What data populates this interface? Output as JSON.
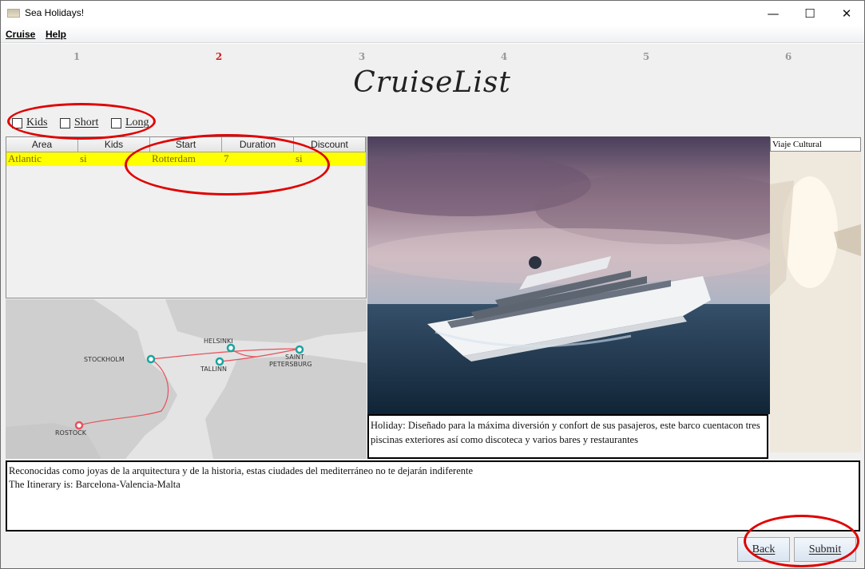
{
  "window": {
    "title": "Sea Holidays!"
  },
  "menu": {
    "items": [
      {
        "label": "Cruise"
      },
      {
        "label": "Help"
      }
    ]
  },
  "steps": {
    "items": [
      "1",
      "2",
      "3",
      "4",
      "5",
      "6"
    ],
    "active": "2"
  },
  "heading": "CruiseList",
  "filters": {
    "kids": "Kids",
    "short": "Short",
    "long": "Long"
  },
  "table": {
    "columns": [
      "Area",
      "Kids",
      "Start",
      "Duration",
      "Discount"
    ],
    "rows": [
      [
        "Atlantic",
        "si",
        "Rotterdam",
        "7",
        "si"
      ]
    ]
  },
  "map": {
    "cities": [
      "HELSINKI",
      "STOCKHOLM",
      "SAINT",
      "PETERSBURG",
      "TALLINN",
      "ROSTOCK"
    ]
  },
  "side": {
    "field": "Viaje Cultural"
  },
  "holiday_text": "Holiday: Diseñado para la máxima diversión y confort de sus pasajeros, este barco cuentacon tres piscinas exteriores así como discoteca y varios bares y restaurantes",
  "description": {
    "line1": "Reconocidas como joyas de la arquitectura y de la historia, estas ciudades del mediterráneo no te dejarán indiferente",
    "line2": "The Itinerary is: Barcelona-Valencia-Malta"
  },
  "buttons": {
    "back": "Back",
    "submit": "Submit"
  },
  "colors": {
    "selected_row": "#ffff00",
    "active_step": "#d21b1b",
    "annotation": "#e00000"
  }
}
